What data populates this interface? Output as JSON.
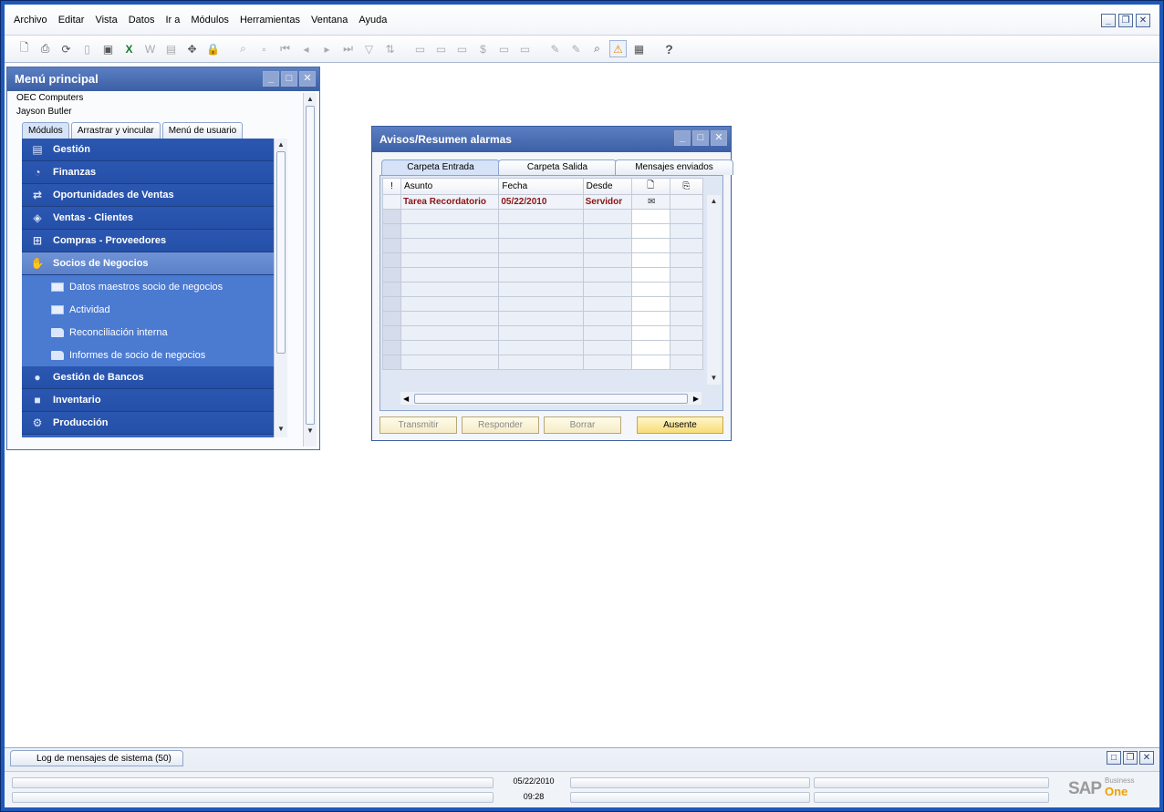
{
  "menubar": {
    "items": [
      "Archivo",
      "Editar",
      "Vista",
      "Datos",
      "Ir a",
      "Módulos",
      "Herramientas",
      "Ventana",
      "Ayuda"
    ]
  },
  "main_menu": {
    "title": "Menú principal",
    "company": "OEC Computers",
    "user": "Jayson Butler",
    "tabs": [
      "Módulos",
      "Arrastrar y vincular",
      "Menú de usuario"
    ],
    "modules": [
      {
        "label": "Gestión",
        "icon": "document-stack-icon"
      },
      {
        "label": "Finanzas",
        "icon": "pie-chart-icon"
      },
      {
        "label": "Oportunidades de Ventas",
        "icon": "arrows-icon"
      },
      {
        "label": "Ventas - Clientes",
        "icon": "price-tag-icon"
      },
      {
        "label": "Compras - Proveedores",
        "icon": "shopping-cart-icon"
      },
      {
        "label": "Socios de Negocios",
        "icon": "handshake-icon"
      }
    ],
    "submodules": [
      {
        "label": "Datos maestros socio de negocios",
        "icon": "form-icon"
      },
      {
        "label": "Actividad",
        "icon": "form-icon"
      },
      {
        "label": "Reconciliación interna",
        "icon": "folder-icon"
      },
      {
        "label": "Informes de socio de negocios",
        "icon": "folder-icon"
      }
    ],
    "modules_after": [
      {
        "label": "Gestión de Bancos",
        "icon": "coins-icon"
      },
      {
        "label": "Inventario",
        "icon": "box-icon"
      },
      {
        "label": "Producción",
        "icon": "gear-icon"
      }
    ]
  },
  "alarm_window": {
    "title": "Avisos/Resumen alarmas",
    "tabs": [
      "Carpeta Entrada",
      "Carpeta Salida",
      "Mensajes enviados"
    ],
    "columns": [
      "!",
      "Asunto",
      "Fecha",
      "Desde"
    ],
    "rows": [
      {
        "asunto": "Tarea Recordatorio",
        "fecha": "05/22/2010",
        "desde": "Servidor"
      }
    ],
    "buttons": [
      "Transmitir",
      "Responder",
      "Borrar",
      "Ausente"
    ]
  },
  "bottom": {
    "log_tab": "Log de mensajes de sistema (50)",
    "date": "05/22/2010",
    "time": "09:28"
  },
  "logo": {
    "sap": "SAP",
    "business": "Business",
    "one": "One"
  },
  "colors": {
    "module_bg": "#2550a8",
    "accent": "#f7dc79",
    "alarm_text": "#8b1414"
  }
}
